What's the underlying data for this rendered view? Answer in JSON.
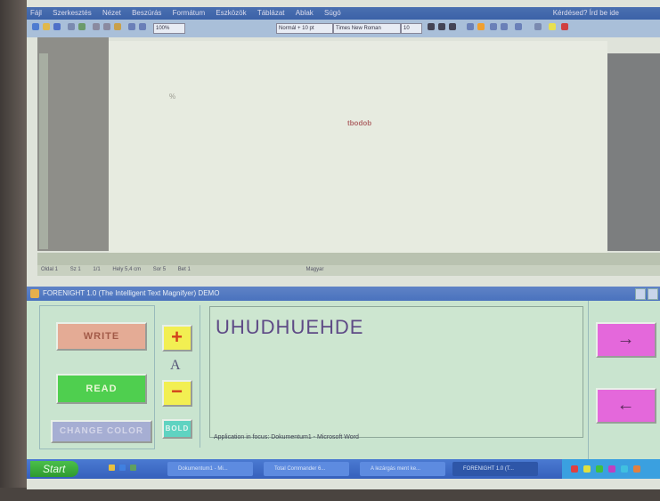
{
  "word": {
    "menu": [
      "Fájl",
      "Szerkesztés",
      "Nézet",
      "Beszúrás",
      "Formátum",
      "Eszközök",
      "Táblázat",
      "Ablak",
      "Súgó"
    ],
    "menu_right": "Kérdésed? Írd be ide",
    "zoom": "100%",
    "style_box": "Normál + 10 pt",
    "font_box": "Times New Roman",
    "size_box": "10",
    "doc_mark1": "%",
    "doc_mark2": "tbodob",
    "status": [
      "Oldal 1",
      "Sz 1",
      "1/1",
      "Hely 5,4 cm",
      "Sor 5",
      "Bet 1",
      "Magyar"
    ]
  },
  "app": {
    "title": "FORENIGHT 1.0 (The Intelligent Text Magnifyer) DEMO",
    "write_label": "WRITE",
    "read_label": "READ",
    "change_color_label": "CHANGE COLOR",
    "plus_label": "+",
    "font_letter": "A",
    "minus_label": "−",
    "bold_label": "BOLD",
    "typed_text": "UHUDHUEHDE",
    "focus_text": "Application in focus: Dokumentum1 - Microsoft Word",
    "arrow_right": "→",
    "arrow_left": "←"
  },
  "taskbar": {
    "start_label": "Start",
    "tasks": [
      "Dokumentum1 - Mi...",
      "Total Commander 6...",
      "A lezárgás ment ke...",
      "FORENIGHT 1.0 (T..."
    ]
  }
}
